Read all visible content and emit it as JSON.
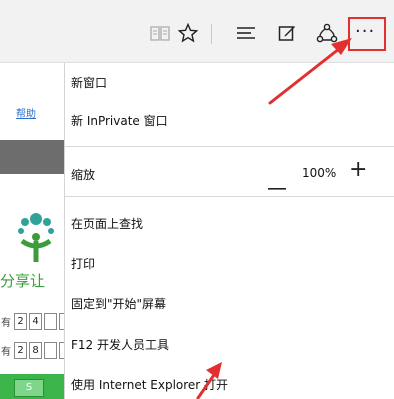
{
  "toolbar": {
    "reading_view_icon": "reading-view-icon",
    "favorite_icon": "star-icon",
    "hub_icon": "hub-icon",
    "note_icon": "web-note-icon",
    "share_icon": "share-icon",
    "more_icon": "more-icon",
    "more_label": "···"
  },
  "page": {
    "help_link": "帮助",
    "slogan": "分享让",
    "rows": [
      {
        "label": "有",
        "cells": [
          "2",
          "4",
          "",
          ""
        ]
      },
      {
        "label": "有",
        "cells": [
          "2",
          "8",
          "",
          ""
        ]
      }
    ],
    "green_button": "S"
  },
  "menu": {
    "new_window": "新窗口",
    "new_inprivate": "新 InPrivate 窗口",
    "zoom_label": "缩放",
    "zoom_minus": "—",
    "zoom_value": "100%",
    "zoom_plus": "+",
    "find_on_page": "在页面上查找",
    "print": "打印",
    "pin_to_start": "固定到\"开始\"屏幕",
    "f12_tools": "F12 开发人员工具",
    "open_with_ie": "使用 Internet Explorer 打开"
  },
  "colors": {
    "accent_red": "#e23030",
    "logo_green": "#3a9c3a",
    "logo_teal": "#2fa39a"
  }
}
